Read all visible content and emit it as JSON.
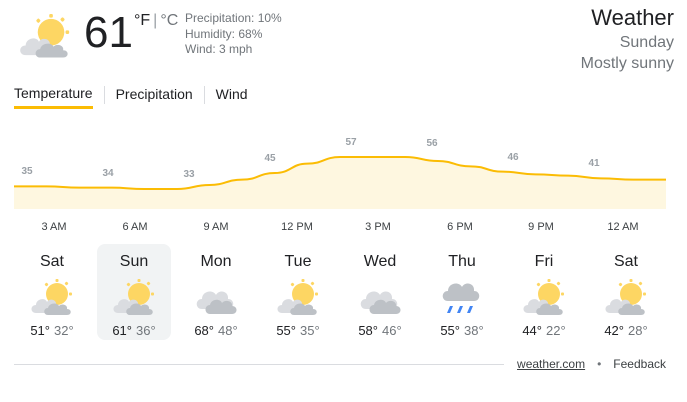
{
  "current": {
    "temperature": "61",
    "unit_f": "°F",
    "unit_c": "°C",
    "icon": "partly-cloudy-icon",
    "precipitation": "Precipitation: 10%",
    "humidity": "Humidity: 68%",
    "wind": "Wind: 3 mph"
  },
  "header": {
    "title": "Weather",
    "day": "Sunday",
    "condition": "Mostly sunny"
  },
  "tabs": [
    {
      "label": "Temperature",
      "active": true
    },
    {
      "label": "Precipitation",
      "active": false
    },
    {
      "label": "Wind",
      "active": false
    }
  ],
  "chart_data": {
    "type": "area",
    "x": [
      "3 AM",
      "6 AM",
      "9 AM",
      "12 PM",
      "3 PM",
      "6 PM",
      "9 PM",
      "12 AM"
    ],
    "values": [
      35,
      34,
      33,
      45,
      57,
      56,
      46,
      41
    ],
    "curve": [
      35,
      35,
      34,
      34,
      33,
      33,
      36,
      40,
      45,
      52,
      57,
      57,
      57,
      54,
      50,
      46,
      44,
      43,
      41,
      40,
      40
    ],
    "line_color": "#fbbc04",
    "fill_color": "#fef7e0"
  },
  "days": [
    {
      "name": "Sat",
      "icon": "partly-cloudy-icon",
      "hi": "51°",
      "lo": "32°",
      "selected": false
    },
    {
      "name": "Sun",
      "icon": "partly-cloudy-icon",
      "hi": "61°",
      "lo": "36°",
      "selected": true
    },
    {
      "name": "Mon",
      "icon": "cloudy-icon",
      "hi": "68°",
      "lo": "48°",
      "selected": false
    },
    {
      "name": "Tue",
      "icon": "partly-cloudy-icon",
      "hi": "55°",
      "lo": "35°",
      "selected": false
    },
    {
      "name": "Wed",
      "icon": "cloudy-icon",
      "hi": "58°",
      "lo": "46°",
      "selected": false
    },
    {
      "name": "Thu",
      "icon": "rain-icon",
      "hi": "55°",
      "lo": "38°",
      "selected": false
    },
    {
      "name": "Fri",
      "icon": "partly-cloudy-icon",
      "hi": "44°",
      "lo": "22°",
      "selected": false
    },
    {
      "name": "Sat",
      "icon": "partly-cloudy-icon",
      "hi": "42°",
      "lo": "28°",
      "selected": false
    }
  ],
  "footer": {
    "source": "weather.com",
    "separator": "•",
    "feedback": "Feedback"
  }
}
